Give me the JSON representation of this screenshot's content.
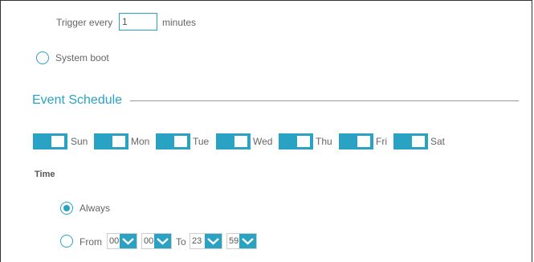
{
  "trigger": {
    "label": "Trigger every",
    "value": "1",
    "unit": "minutes"
  },
  "system_boot": {
    "label": "System boot",
    "checked": false
  },
  "event_schedule": {
    "title": "Event Schedule",
    "days": [
      {
        "label": "Sun",
        "enabled": true
      },
      {
        "label": "Mon",
        "enabled": true
      },
      {
        "label": "Tue",
        "enabled": true
      },
      {
        "label": "Wed",
        "enabled": true
      },
      {
        "label": "Thu",
        "enabled": true
      },
      {
        "label": "Fri",
        "enabled": true
      },
      {
        "label": "Sat",
        "enabled": true
      }
    ]
  },
  "time": {
    "label": "Time",
    "always": {
      "label": "Always",
      "checked": true
    },
    "from": {
      "label": "From",
      "checked": false,
      "start_hour": "00",
      "start_minute": "00",
      "to_label": "To",
      "end_hour": "23",
      "end_minute": "59"
    }
  },
  "colors": {
    "accent": "#2aa2c4",
    "text": "#666666",
    "rule": "#9a9a9a"
  },
  "icons": {
    "dropdown": "chevron-down-icon"
  }
}
